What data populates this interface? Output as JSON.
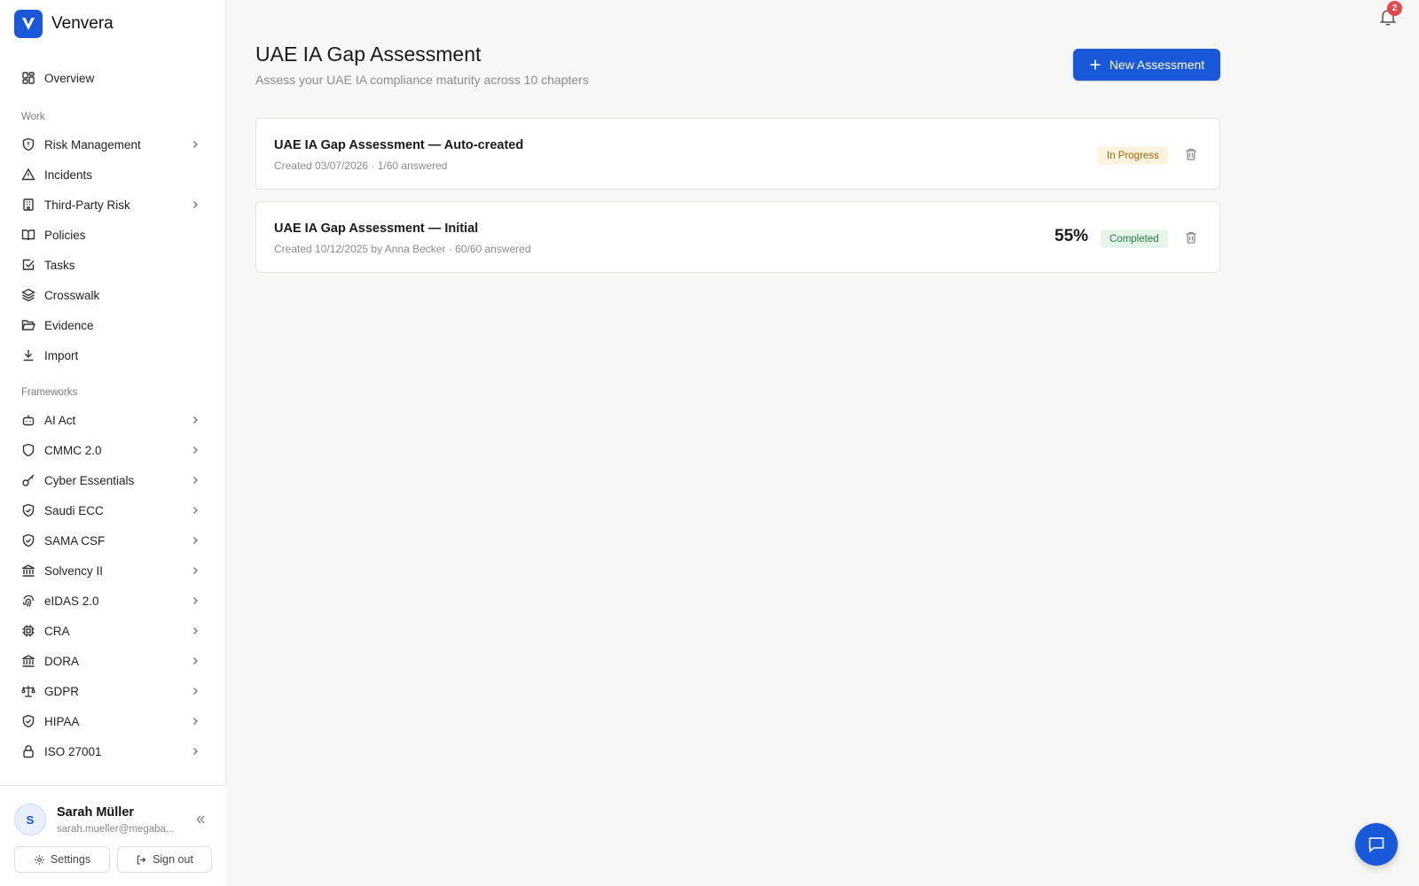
{
  "brand": {
    "name": "Venvera",
    "logo_letter": "V",
    "color": "#1958d8"
  },
  "sidebar": {
    "overview": {
      "label": "Overview",
      "icon": "grid-icon"
    },
    "work_label": "Work",
    "work_items": [
      {
        "label": "Risk Management",
        "icon": "shield-alert-icon",
        "expandable": true
      },
      {
        "label": "Incidents",
        "icon": "warning-triangle-icon",
        "expandable": false
      },
      {
        "label": "Third-Party Risk",
        "icon": "building-icon",
        "expandable": true
      },
      {
        "label": "Policies",
        "icon": "book-open-icon",
        "expandable": false
      },
      {
        "label": "Tasks",
        "icon": "checkbox-icon",
        "expandable": false
      },
      {
        "label": "Crosswalk",
        "icon": "layers-icon",
        "expandable": false
      },
      {
        "label": "Evidence",
        "icon": "folder-open-icon",
        "expandable": false
      },
      {
        "label": "Import",
        "icon": "download-icon",
        "expandable": false
      }
    ],
    "frameworks_label": "Frameworks",
    "framework_items": [
      {
        "label": "AI Act",
        "icon": "bot-icon",
        "expandable": true
      },
      {
        "label": "CMMC 2.0",
        "icon": "shield-icon",
        "expandable": true
      },
      {
        "label": "Cyber Essentials",
        "icon": "key-icon",
        "expandable": true
      },
      {
        "label": "Saudi ECC",
        "icon": "shield-check-icon",
        "expandable": true
      },
      {
        "label": "SAMA CSF",
        "icon": "shield-check-icon",
        "expandable": true
      },
      {
        "label": "Solvency II",
        "icon": "bank-icon",
        "expandable": true
      },
      {
        "label": "eIDAS 2.0",
        "icon": "fingerprint-icon",
        "expandable": true
      },
      {
        "label": "CRA",
        "icon": "chip-icon",
        "expandable": true
      },
      {
        "label": "DORA",
        "icon": "bank-icon",
        "expandable": true
      },
      {
        "label": "GDPR",
        "icon": "scale-icon",
        "expandable": true
      },
      {
        "label": "HIPAA",
        "icon": "shield-check-icon",
        "expandable": true
      },
      {
        "label": "ISO 27001",
        "icon": "lock-icon",
        "expandable": true
      }
    ]
  },
  "user": {
    "initial": "S",
    "name": "Sarah Müller",
    "email": "sarah.mueller@megaba...",
    "settings_label": "Settings",
    "signout_label": "Sign out"
  },
  "header": {
    "title": "UAE IA Gap Assessment",
    "subtitle": "Assess your UAE IA compliance maturity across 10 chapters",
    "new_button_label": "New Assessment",
    "notifications_count": "2"
  },
  "assessments": [
    {
      "title": "UAE IA Gap Assessment — Auto-created",
      "meta": "Created 03/07/2026 · 1/60 answered",
      "score": "",
      "status": "In Progress",
      "status_type": "progress"
    },
    {
      "title": "UAE IA Gap Assessment — Initial",
      "meta": "Created 10/12/2025 by Anna Becker · 60/60 answered",
      "score": "55%",
      "status": "Completed",
      "status_type": "done"
    }
  ]
}
